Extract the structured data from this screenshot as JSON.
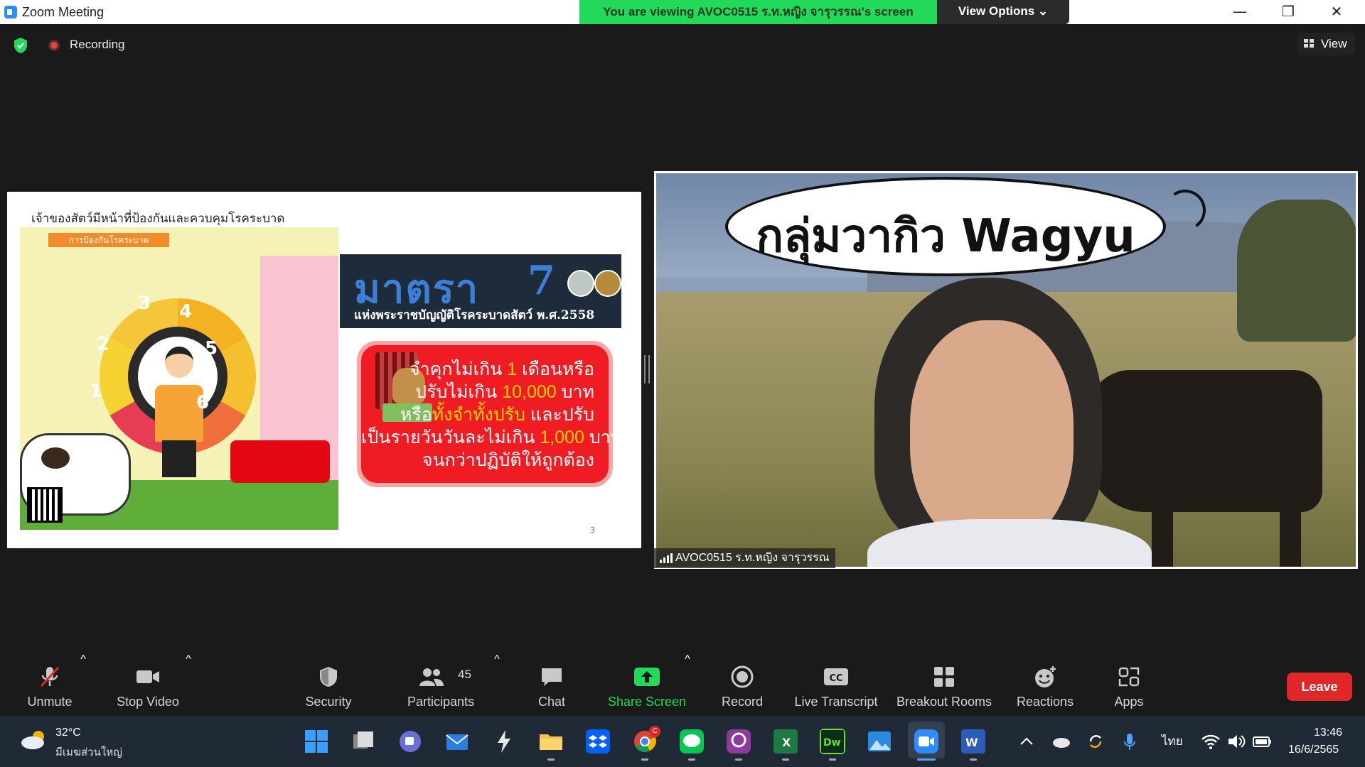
{
  "window": {
    "title": "Zoom Meeting",
    "viewing_banner": "You are viewing AVOC0515 ร.ท.หญิง จารุวรรณ's screen",
    "view_options_label": "View Options ⌄",
    "minimize": "—",
    "maximize": "❐",
    "close": "✕"
  },
  "meeting": {
    "recording_label": "Recording",
    "view_label": "View"
  },
  "slide": {
    "heading": "เจ้าของสัตว์มีหน้าที่ป้องกันและควบคุมโรคระบาด",
    "ribbon": "การป้องกันโรคระบาด",
    "segment_numbers": [
      "1",
      "2",
      "3",
      "4",
      "5",
      "6"
    ],
    "law_title": "มาตรา 7",
    "law_title_word": "มาตรา",
    "law_title_num": "7",
    "law_subtitle": "แห่งพระราชบัญญัติโรคระบาดสัตว์ พ.ศ.2558",
    "penalty_lines": [
      {
        "pre": "จำคุกไม่เกิน ",
        "hl": "1",
        "post": " เดือนหรือ"
      },
      {
        "pre": "ปรับไม่เกิน ",
        "hl": "10,000",
        "post": " บาท"
      },
      {
        "pre": "หรือ",
        "hl": "ทั้งจำทั้งปรับ",
        "post": " และปรับ"
      },
      {
        "pre": "เป็นรายวันวันละไม่เกิน ",
        "hl": "1,000",
        "post": " บาท"
      },
      {
        "pre": "จนกว่าปฏิบัติให้ถูกต้อง",
        "hl": "",
        "post": ""
      }
    ],
    "page_number": "3"
  },
  "video": {
    "cloud_text": "กลุ่มวากิว Wagyu",
    "participant_name": "AVOC0515 ร.ท.หญิง จารุวรรณ"
  },
  "toolbar": {
    "unmute": "Unmute",
    "stop_video": "Stop Video",
    "security": "Security",
    "participants": "Participants",
    "participants_count": "45",
    "chat": "Chat",
    "share_screen": "Share Screen",
    "record": "Record",
    "live_transcript": "Live Transcript",
    "breakout_rooms": "Breakout Rooms",
    "reactions": "Reactions",
    "apps": "Apps",
    "leave": "Leave",
    "caret": "^"
  },
  "taskbar": {
    "weather_temp": "32°C",
    "weather_desc": "มีเมฆส่วนใหญ่",
    "language": "ไทย",
    "time": "13:46",
    "date": "16/6/2565",
    "chrome_badge": "C"
  },
  "colors": {
    "banner_green": "#23d959",
    "share_green": "#23d959",
    "leave_red": "#e02828",
    "zoom_blue": "#2d8cff"
  }
}
